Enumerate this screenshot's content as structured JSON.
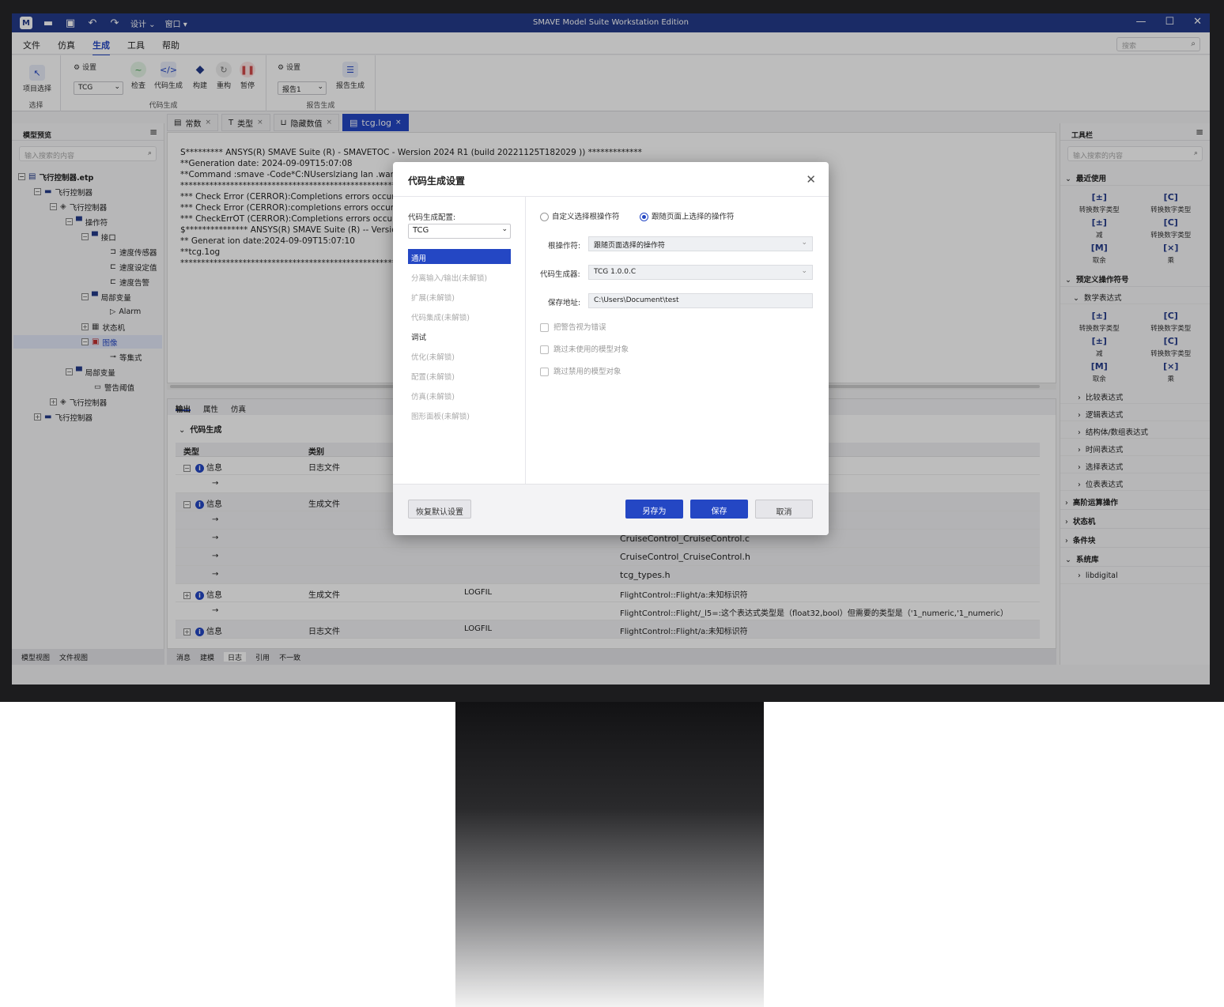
{
  "window": {
    "title": "SMAVE Model Suite Workstation Edition",
    "design_menu": "设计",
    "window_menu": "窗口",
    "minimize": "—",
    "maximize": "☐",
    "close": "✕"
  },
  "menu": [
    "文件",
    "仿真",
    "生成",
    "工具",
    "帮助"
  ],
  "search_placeholder": "搜索",
  "ribbon": {
    "proj_select": "项目选择",
    "sel_group": "选择",
    "settings": "设置",
    "tcg_value": "TCG",
    "check": "检查",
    "codegen": "代码生成",
    "build": "构建",
    "rebuild": "重构",
    "pause": "暂停",
    "codegen_group": "代码生成",
    "report_settings": "设置",
    "report_value": "报告1",
    "report_gen": "报告生成",
    "report_group": "报告生成"
  },
  "left_pane": {
    "title": "模型预览",
    "search_placeholder": "输入搜索的内容",
    "tree": [
      "飞行控制器.etp",
      "飞行控制器",
      "飞行控制器",
      "操作符",
      "接口",
      "速度传感器",
      "速度设定值",
      "速度告警",
      "局部变量",
      "Alarm",
      "状态机",
      "图像",
      "等集式",
      "局部变量",
      "警告阈值",
      "飞行控制器",
      "飞行控制器"
    ],
    "footer": [
      "模型视图",
      "文件视图"
    ]
  },
  "tabs": [
    {
      "label": "常数"
    },
    {
      "label": "类型"
    },
    {
      "label": "隐藏数值"
    },
    {
      "label": "tcg.log"
    }
  ],
  "log_lines": [
    "S********* ANSYS(R) SMAVE Suite (R) - SMAVETOC - Wersion 2024 R1 (build 20221125T182029 )) *************",
    "**Generation date: 2024-09-09T15:07:08",
    "**Command :smave -Code*C:NUserslziang lan .wang D",
    "*************************************************************$",
    "*** Check Error (CERROR):Completions errors occur durir",
    "*** Check Error (CERROR):completions errors occur durin",
    "*** CheckErrOT (CERROR):Completions errors occur durir",
    "$*************** ANSYS(R) SMAVE Suite (R) -- Version 202",
    "** Generat ion date:2024-09-09T15:07:10",
    "**tcg.1og",
    "*************************************************************$"
  ],
  "bottom": {
    "tabs": [
      "输出",
      "属性",
      "仿真"
    ],
    "section": "代码生成",
    "headers": [
      "类型",
      "类别"
    ],
    "rows": [
      {
        "type": "信息",
        "cat": "日志文件",
        "c3": "",
        "c4": ""
      },
      {
        "type": "→",
        "cat": "",
        "c3": "",
        "c4": ""
      },
      {
        "type": "信息",
        "cat": "生成文件",
        "c3": "",
        "c4": ""
      },
      {
        "type": "→",
        "cat": "",
        "c3": "",
        "c4": ""
      },
      {
        "type": "→",
        "cat": "",
        "c3": "",
        "c4": "CruiseControl_CruiseControl.c"
      },
      {
        "type": "→",
        "cat": "",
        "c3": "",
        "c4": "CruiseControl_CruiseControl.h"
      },
      {
        "type": "→",
        "cat": "",
        "c3": "",
        "c4": "tcg_types.h"
      },
      {
        "type": "信息",
        "cat": "生成文件",
        "c3": "LOGFIL",
        "c4": "FlightControl::Flight/a:未知标识符"
      },
      {
        "type": "→",
        "cat": "",
        "c3": "",
        "c4": "FlightControl::Flight/_l5=:这个表达式类型是（float32,bool）但需要的类型是（'1_numeric,'1_numeric）"
      },
      {
        "type": "信息",
        "cat": "日志文件",
        "c3": "LOGFIL",
        "c4": "FlightControl::Flight/a:未知标识符"
      }
    ],
    "footer": [
      "消息",
      "建模",
      "日志",
      "引用",
      "不一致"
    ]
  },
  "right_pane": {
    "title": "工具栏",
    "search_placeholder": "输入搜索的内容",
    "recent": "最近使用",
    "ops": [
      {
        "sym": "[±]",
        "label": "转换数字类型"
      },
      {
        "sym": "[C]",
        "label": "转换数字类型"
      },
      {
        "sym": "[±]",
        "label": "减"
      },
      {
        "sym": "[C]",
        "label": "转换数字类型"
      },
      {
        "sym": "[M]",
        "label": "取余"
      },
      {
        "sym": "[×]",
        "label": "乘"
      }
    ],
    "predef": "预定义操作符号",
    "math": "数学表达式",
    "subs": [
      "比较表达式",
      "逻辑表达式",
      "结构体/数组表达式",
      "时间表达式",
      "选择表达式",
      "位表表达式"
    ],
    "sections": [
      "高阶运算操作",
      "状态机",
      "条件块",
      "系统库"
    ],
    "lib": "libdigital"
  },
  "dialog": {
    "title": "代码生成设置",
    "config_label": "代码生成配置:",
    "config_value": "TCG",
    "nav": [
      "通用",
      "分离输入/输出(未解锁)",
      "扩展(未解锁)",
      "代码集成(未解锁)",
      "调试",
      "优化(未解锁)",
      "配置(未解锁)",
      "仿真(未解锁)",
      "图形面板(未解锁)"
    ],
    "radio1": "自定义选择根操作符",
    "radio2": "跟随页面上选择的操作符",
    "root_label": "根操作符:",
    "root_value": "跟随页面选择的操作符",
    "gen_label": "代码生成器:",
    "gen_value": "TCG 1.0.0.C",
    "path_label": "保存地址:",
    "path_value": "C:\\Users\\Document\\test",
    "chk1": "把警告视为错误",
    "chk2": "跳过未使用的模型对象",
    "chk3": "跳过禁用的模型对象",
    "restore": "恢复默认设置",
    "save_as": "另存为",
    "save": "保存",
    "cancel": "取消"
  }
}
